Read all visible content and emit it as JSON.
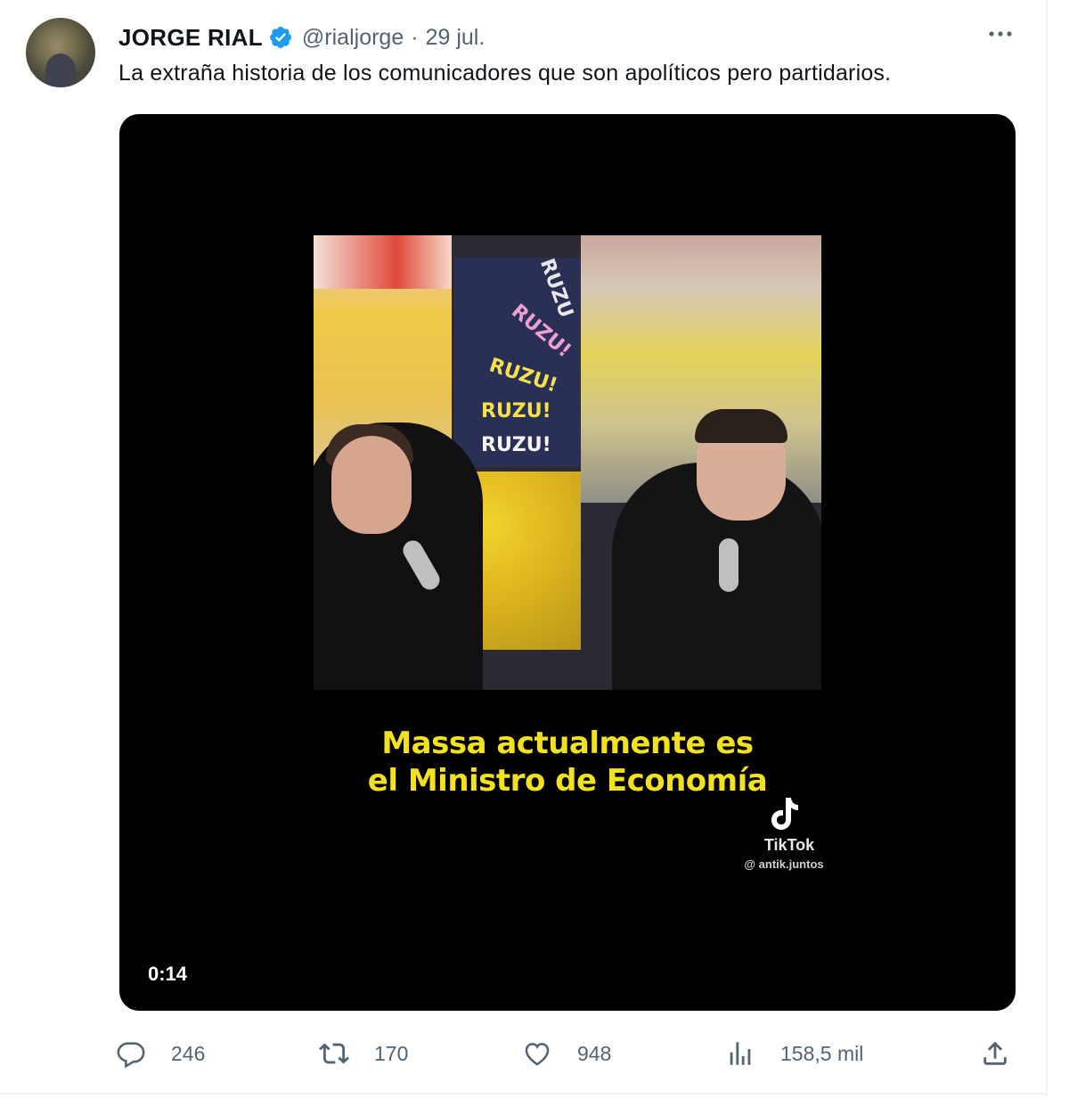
{
  "tweet": {
    "author_name": "JORGE RIAL",
    "handle": "@rialjorge",
    "separator": "·",
    "date": "29 jul.",
    "text": "La extraña historia de los comunicadores que son apolíticos pero partidarios."
  },
  "media": {
    "caption_line1": "Massa actualmente es",
    "caption_line2": "el Ministro de Economía",
    "watermark_label": "TikTok",
    "watermark_handle": "@ antik.juntos",
    "duration": "0:14",
    "poster_text": [
      "RUZU",
      "RUZU!",
      "RUZU!",
      "RUZU!",
      "RUZU!"
    ]
  },
  "actions": {
    "replies": "246",
    "retweets": "170",
    "likes": "948",
    "views": "158,5 mil"
  },
  "colors": {
    "verified": "#1d9bf0",
    "secondary_text": "#536471",
    "caption": "#f3e21b"
  },
  "icons": [
    "verified-badge-icon",
    "more-icon",
    "tiktok-icon",
    "reply-icon",
    "retweet-icon",
    "like-icon",
    "views-icon",
    "share-icon"
  ]
}
